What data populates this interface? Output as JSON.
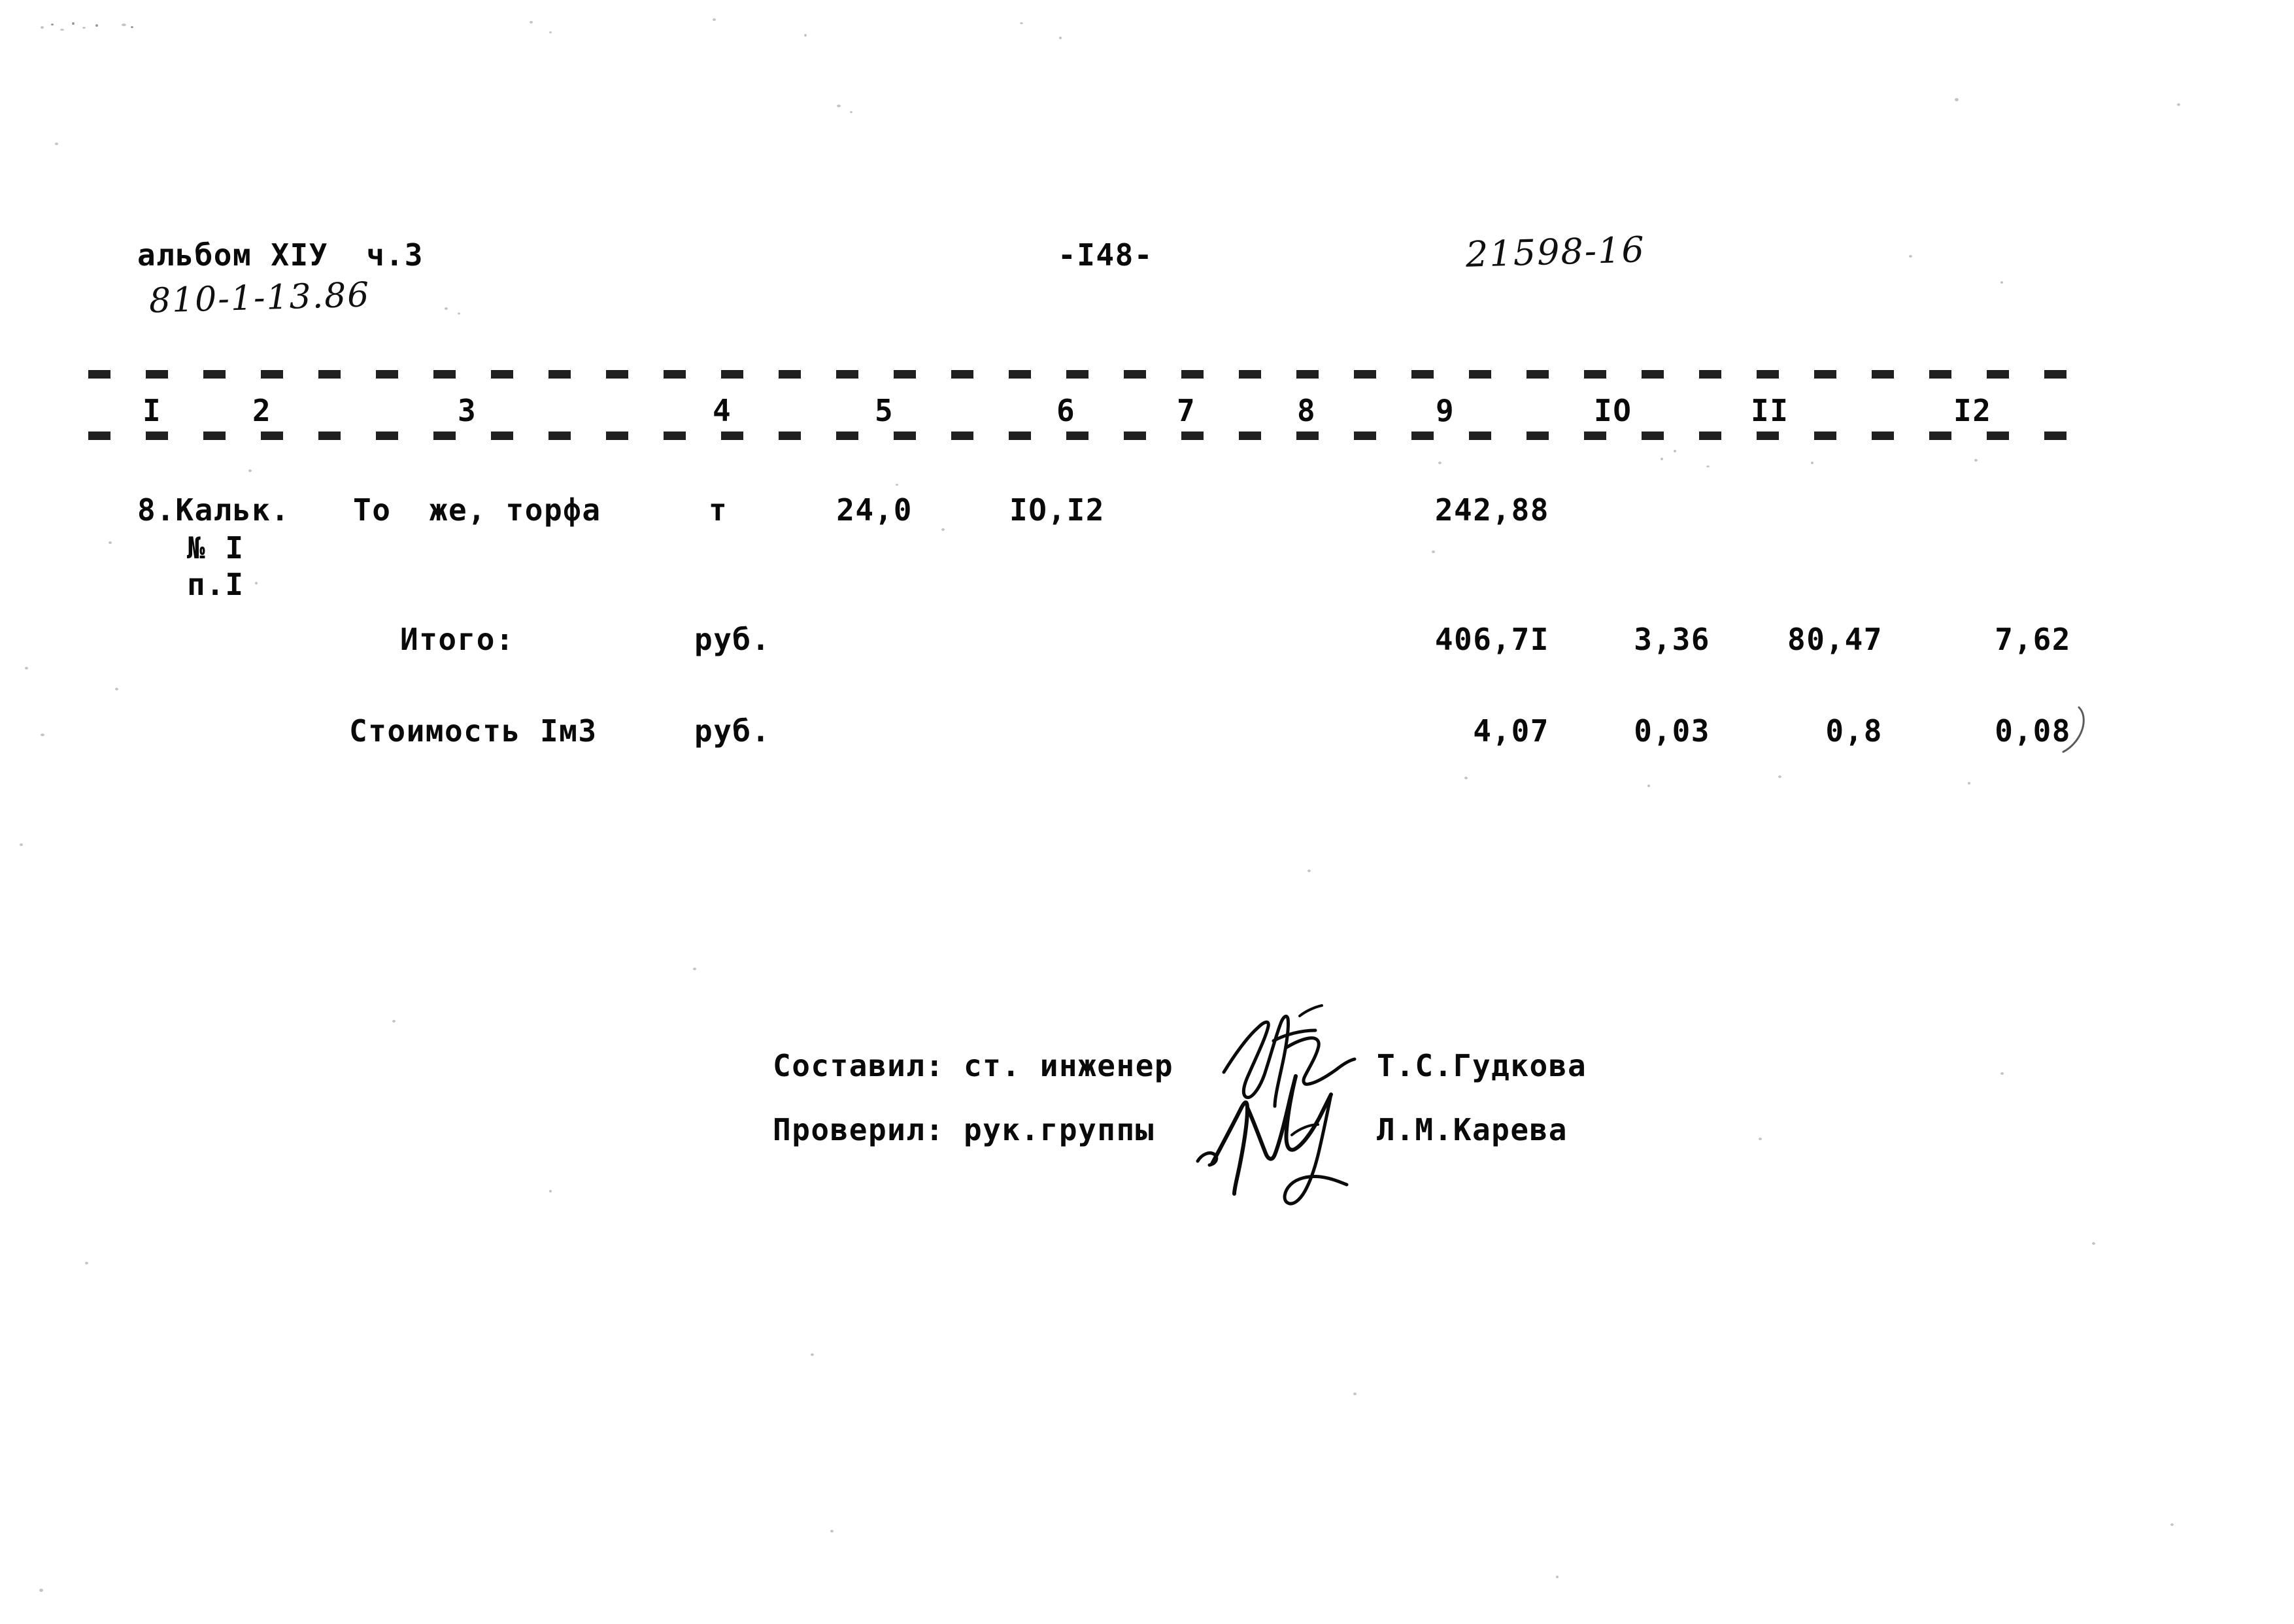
{
  "document": {
    "album_label": "альбом XIУ  ч.3",
    "drawing_code_handwritten": "810-1-13.86",
    "page_number": "-I48-",
    "archive_code_handwritten": "21598-16"
  },
  "table": {
    "column_headers": [
      "I",
      "2",
      "3",
      "4",
      "5",
      "6",
      "7",
      "8",
      "9",
      "IO",
      "II",
      "I2"
    ],
    "rows": [
      {
        "name": "line-item-8",
        "c1_line1": "8.Кальк.",
        "c1_line2": "№ I",
        "c1_line3": "п.I",
        "c3": "То  же, торфа",
        "c4": "т",
        "c5": "24,0",
        "c6": "IO,I2",
        "c7": "",
        "c8": "",
        "c9": "242,88",
        "c10": "",
        "c11": "",
        "c12": ""
      },
      {
        "name": "total-row",
        "label": "Итого:",
        "unit": "руб.",
        "c9": "406,7I",
        "c10": "3,36",
        "c11": "80,47",
        "c12": "7,62"
      },
      {
        "name": "unit-cost-row",
        "label": "Стоимость Iм3",
        "unit": "руб.",
        "c9": "4,07",
        "c10": "0,03",
        "c11": "0,8",
        "c12": "0,08"
      }
    ]
  },
  "signatures": {
    "prepared_by": {
      "label": "Составил: ст. инженер",
      "name": "Т.С.Гудкова",
      "signature_icon": "handwritten-signature-icon"
    },
    "checked_by": {
      "label": "Проверил: рук.группы",
      "name": "Л.М.Карева",
      "signature_icon": "handwritten-signature-icon"
    }
  },
  "colors": {
    "ink": "#0a0a0a",
    "paper": "#ffffff",
    "pen": "#0b0b0b",
    "speckle": "#9a9a9a"
  }
}
